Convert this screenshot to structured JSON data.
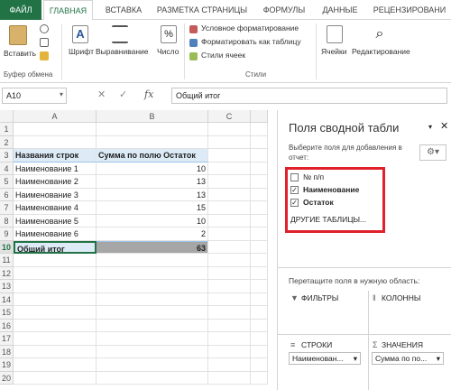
{
  "ribbon_tabs": [
    "ФАЙЛ",
    "ГЛАВНАЯ",
    "ВСТАВКА",
    "РАЗМЕТКА СТРАНИЦЫ",
    "ФОРМУЛЫ",
    "ДАННЫЕ",
    "РЕЦЕНЗИРОВАНИ"
  ],
  "ribbon": {
    "paste": "Вставить",
    "clipboard_group": "Буфер обмена",
    "font": "Шрифт",
    "alignment": "Выравнивание",
    "number": "Число",
    "cond_format": "Условное форматирование",
    "format_table": "Форматировать как таблицу",
    "cell_styles": "Стили ячеек",
    "styles_group": "Стили",
    "cells": "Ячейки",
    "editing": "Редактирование",
    "percent": "%"
  },
  "formula_bar": {
    "name_box": "A10",
    "fx": "fx",
    "formula": "Общий итог"
  },
  "grid": {
    "columns": [
      "A",
      "B",
      "C"
    ],
    "rows": [
      "1",
      "2",
      "3",
      "4",
      "5",
      "6",
      "7",
      "8",
      "9",
      "10",
      "11",
      "12",
      "13",
      "14",
      "15",
      "16",
      "17",
      "18",
      "19",
      "20"
    ],
    "header_a": "Названия строк",
    "header_b": "Сумма по полю Остаток",
    "items": [
      {
        "name": "Наименование 1",
        "value": "10"
      },
      {
        "name": "Наименование 2",
        "value": "13"
      },
      {
        "name": "Наименование 3",
        "value": "13"
      },
      {
        "name": "Наименование 4",
        "value": "15"
      },
      {
        "name": "Наименование 5",
        "value": "10"
      },
      {
        "name": "Наименование 6",
        "value": "2"
      }
    ],
    "total_label": "Общий итог",
    "total_value": "63"
  },
  "pivot_pane": {
    "title": "Поля сводной табли",
    "subtitle": "Выберите поля для добавления в отчет:",
    "fields": [
      {
        "label": "№ п/п",
        "checked": false
      },
      {
        "label": "Наименование",
        "checked": true
      },
      {
        "label": "Остаток",
        "checked": true
      }
    ],
    "check_mark": "✓",
    "more_tables": "ДРУГИЕ ТАБЛИЦЫ...",
    "drag_hint": "Перетащите поля в нужную область:",
    "filters": "ФИЛЬТРЫ",
    "columns": "КОЛОННЫ",
    "rows": "СТРОКИ",
    "values": "ЗНАЧЕНИЯ",
    "rows_field": "Наименован...",
    "values_field": "Сумма по по...",
    "highlight_color": "#e0202a"
  }
}
